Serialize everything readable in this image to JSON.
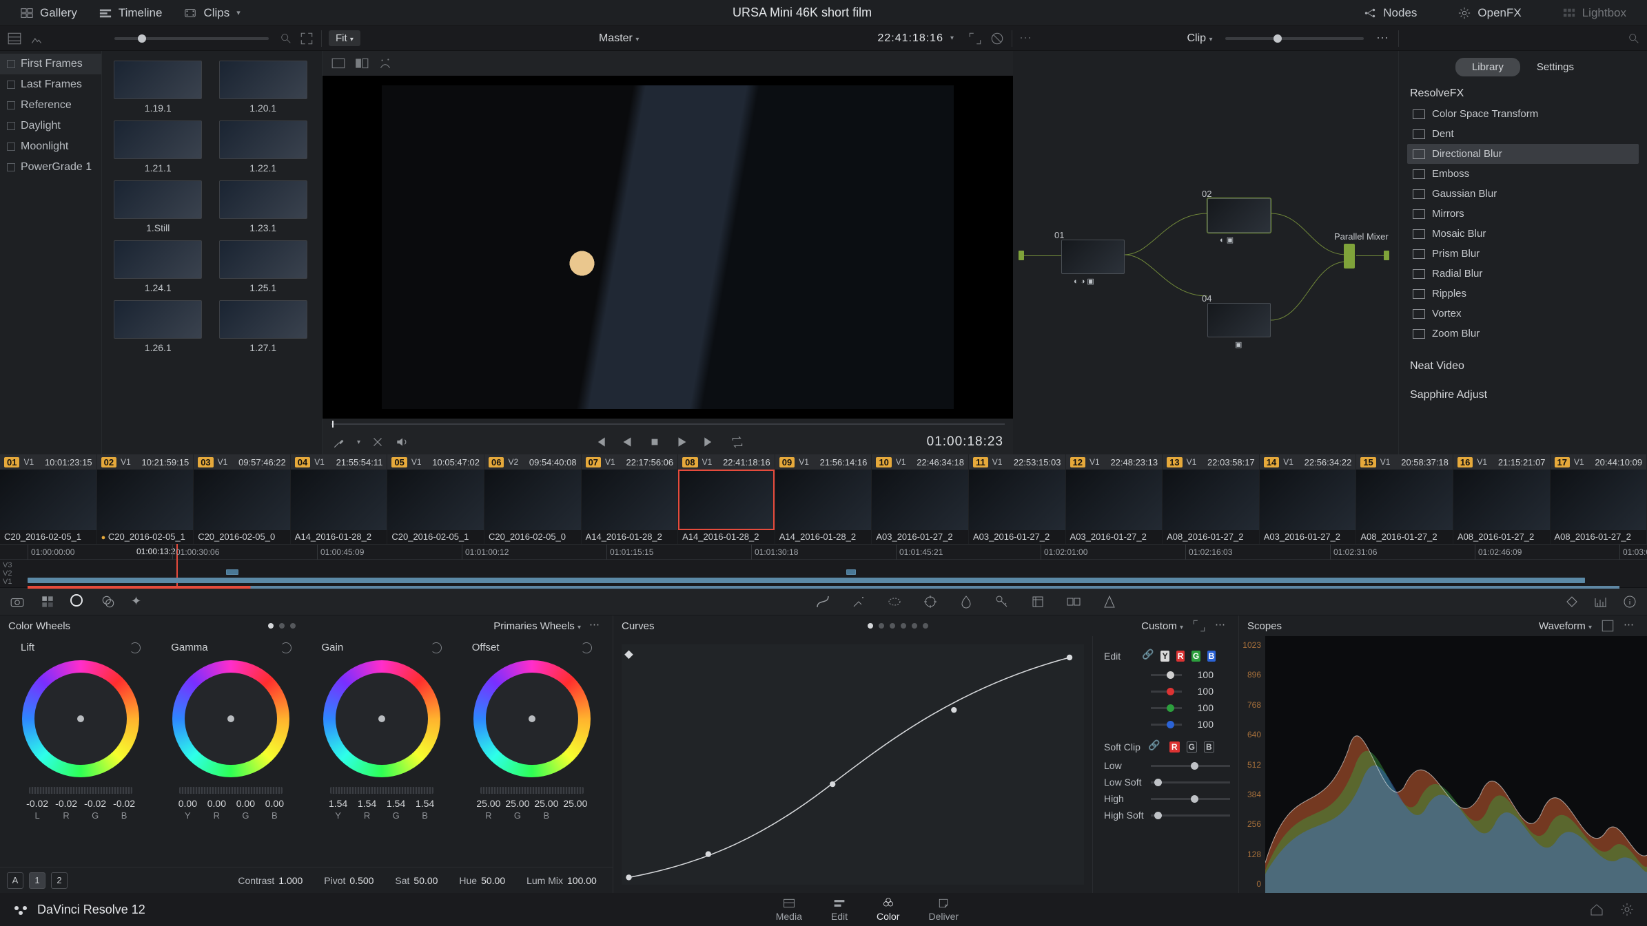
{
  "menubar": {
    "gallery": "Gallery",
    "timeline": "Timeline",
    "clips": "Clips",
    "title": "URSA Mini 46K short film",
    "nodes": "Nodes",
    "openfx": "OpenFX",
    "lightbox": "Lightbox"
  },
  "subbar": {
    "fit": "Fit",
    "master": "Master",
    "master_tc": "22:41:18:16",
    "clip": "Clip"
  },
  "gallery": [
    "First Frames",
    "Last Frames",
    "Reference",
    "Daylight",
    "Moonlight",
    "PowerGrade 1"
  ],
  "thumbs": [
    "1.19.1",
    "1.20.1",
    "1.21.1",
    "1.22.1",
    "1.Still",
    "1.23.1",
    "1.24.1",
    "1.25.1",
    "1.26.1",
    "1.27.1"
  ],
  "viewer": {
    "timecode": "01:00:18:23"
  },
  "nodes": {
    "n01": "01",
    "n02": "02",
    "n03": "04",
    "mixer": "Parallel Mixer"
  },
  "fx": {
    "tabs": {
      "library": "Library",
      "settings": "Settings"
    },
    "group": "ResolveFX",
    "items": [
      "Color Space Transform",
      "Dent",
      "Directional Blur",
      "Emboss",
      "Gaussian Blur",
      "Mirrors",
      "Mosaic Blur",
      "Prism Blur",
      "Radial Blur",
      "Ripples",
      "Vortex",
      "Zoom Blur"
    ],
    "group2": "Neat Video",
    "group3": "Sapphire Adjust"
  },
  "clips": [
    {
      "n": "01",
      "v": "V1",
      "tc": "10:01:23:15",
      "name": "C20_2016-02-05_1"
    },
    {
      "n": "02",
      "v": "V1",
      "tc": "10:21:59:15",
      "name": "C20_2016-02-05_1"
    },
    {
      "n": "03",
      "v": "V1",
      "tc": "09:57:46:22",
      "name": "C20_2016-02-05_0"
    },
    {
      "n": "04",
      "v": "V1",
      "tc": "21:55:54:11",
      "name": "A14_2016-01-28_2"
    },
    {
      "n": "05",
      "v": "V1",
      "tc": "10:05:47:02",
      "name": "C20_2016-02-05_1"
    },
    {
      "n": "06",
      "v": "V2",
      "tc": "09:54:40:08",
      "name": "C20_2016-02-05_0"
    },
    {
      "n": "07",
      "v": "V1",
      "tc": "22:17:56:06",
      "name": "A14_2016-01-28_2"
    },
    {
      "n": "08",
      "v": "V1",
      "tc": "22:41:18:16",
      "name": "A14_2016-01-28_2"
    },
    {
      "n": "09",
      "v": "V1",
      "tc": "21:56:14:16",
      "name": "A14_2016-01-28_2"
    },
    {
      "n": "10",
      "v": "V1",
      "tc": "22:46:34:18",
      "name": "A03_2016-01-27_2"
    },
    {
      "n": "11",
      "v": "V1",
      "tc": "22:53:15:03",
      "name": "A03_2016-01-27_2"
    },
    {
      "n": "12",
      "v": "V1",
      "tc": "22:48:23:13",
      "name": "A03_2016-01-27_2"
    },
    {
      "n": "13",
      "v": "V1",
      "tc": "22:03:58:17",
      "name": "A08_2016-01-27_2"
    },
    {
      "n": "14",
      "v": "V1",
      "tc": "22:56:34:22",
      "name": "A03_2016-01-27_2"
    },
    {
      "n": "15",
      "v": "V1",
      "tc": "20:58:37:18",
      "name": "A08_2016-01-27_2"
    },
    {
      "n": "16",
      "v": "V1",
      "tc": "21:15:21:07",
      "name": "A08_2016-01-27_2"
    },
    {
      "n": "17",
      "v": "V1",
      "tc": "20:44:10:09",
      "name": "A08_2016-01-27_2"
    }
  ],
  "minitl": {
    "ticks": [
      "01:00:00:00",
      "01:00:30:06",
      "01:00:45:09",
      "01:01:00:12",
      "01:01:15:15",
      "01:01:30:18",
      "01:01:45:21",
      "01:02:01:00",
      "01:02:16:03",
      "01:02:31:06",
      "01:02:46:09",
      "01:03:01:12"
    ],
    "playhead_tc": "01:00:13:2",
    "tracks": [
      "V3",
      "V2",
      "V1"
    ]
  },
  "wheels": {
    "header": "Color Wheels",
    "mode": "Primaries Wheels",
    "items": [
      {
        "name": "Lift",
        "vals": [
          "-0.02",
          "-0.02",
          "-0.02",
          "-0.02"
        ],
        "labs": [
          "L",
          "R",
          "G",
          "B"
        ]
      },
      {
        "name": "Gamma",
        "vals": [
          "0.00",
          "0.00",
          "0.00",
          "0.00"
        ],
        "labs": [
          "Y",
          "R",
          "G",
          "B"
        ]
      },
      {
        "name": "Gain",
        "vals": [
          "1.54",
          "1.54",
          "1.54",
          "1.54"
        ],
        "labs": [
          "Y",
          "R",
          "G",
          "B"
        ]
      },
      {
        "name": "Offset",
        "vals": [
          "25.00",
          "25.00",
          "25.00",
          "25.00"
        ],
        "labs": [
          "R",
          "G",
          "B",
          ""
        ]
      }
    ]
  },
  "curves": {
    "header": "Curves",
    "mode": "Custom",
    "edit_lbl": "Edit",
    "softclip_lbl": "Soft Clip",
    "rows": [
      {
        "lab": "",
        "val": "100"
      },
      {
        "lab": "",
        "val": "100"
      },
      {
        "lab": "",
        "val": "100"
      },
      {
        "lab": "",
        "val": "100"
      }
    ],
    "soft": [
      {
        "lab": "Low",
        "val": ""
      },
      {
        "lab": "Low Soft",
        "val": ""
      },
      {
        "lab": "High",
        "val": ""
      },
      {
        "lab": "High Soft",
        "val": ""
      }
    ]
  },
  "scopes": {
    "header": "Scopes",
    "mode": "Waveform",
    "ticks": [
      "1023",
      "896",
      "768",
      "640",
      "512",
      "384",
      "256",
      "128",
      "0"
    ]
  },
  "adjust": {
    "contrast_l": "Contrast",
    "contrast_v": "1.000",
    "pivot_l": "Pivot",
    "pivot_v": "0.500",
    "sat_l": "Sat",
    "sat_v": "50.00",
    "hue_l": "Hue",
    "hue_v": "50.00",
    "lummix_l": "Lum Mix",
    "lummix_v": "100.00",
    "a": "A",
    "one": "1",
    "two": "2"
  },
  "bottom": {
    "brand": "DaVinci Resolve 12",
    "pages": [
      "Media",
      "Edit",
      "Color",
      "Deliver"
    ]
  }
}
